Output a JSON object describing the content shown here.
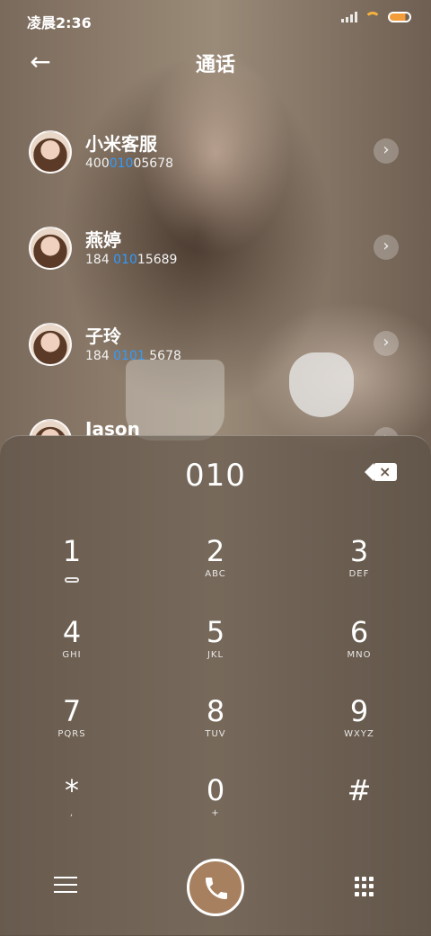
{
  "status": {
    "time": "凌晨2:36"
  },
  "header": {
    "title": "通话",
    "back_icon": "←"
  },
  "contacts": [
    {
      "name": "小米客服",
      "num_pre": "400",
      "num_hl": "010",
      "num_post": "05678"
    },
    {
      "name": "燕婷",
      "num_pre": "184 ",
      "num_hl": "010",
      "num_post": "15689"
    },
    {
      "name": "子玲",
      "num_pre": "184 ",
      "num_hl": "0101",
      "num_post": " 5678"
    },
    {
      "name": "Jason",
      "num_pre": "",
      "num_hl": "",
      "num_post": ""
    }
  ],
  "dialpad": {
    "display": "010",
    "keys": [
      {
        "d": "1",
        "l": ""
      },
      {
        "d": "2",
        "l": "ABC"
      },
      {
        "d": "3",
        "l": "DEF"
      },
      {
        "d": "4",
        "l": "GHI"
      },
      {
        "d": "5",
        "l": "JKL"
      },
      {
        "d": "6",
        "l": "MNO"
      },
      {
        "d": "7",
        "l": "PQRS"
      },
      {
        "d": "8",
        "l": "TUV"
      },
      {
        "d": "9",
        "l": "WXYZ"
      },
      {
        "d": "*",
        "l": ","
      },
      {
        "d": "0",
        "l": "+"
      },
      {
        "d": "#",
        "l": ""
      }
    ]
  },
  "colors": {
    "highlight": "#2f9bff",
    "call_button": "#a78060"
  }
}
